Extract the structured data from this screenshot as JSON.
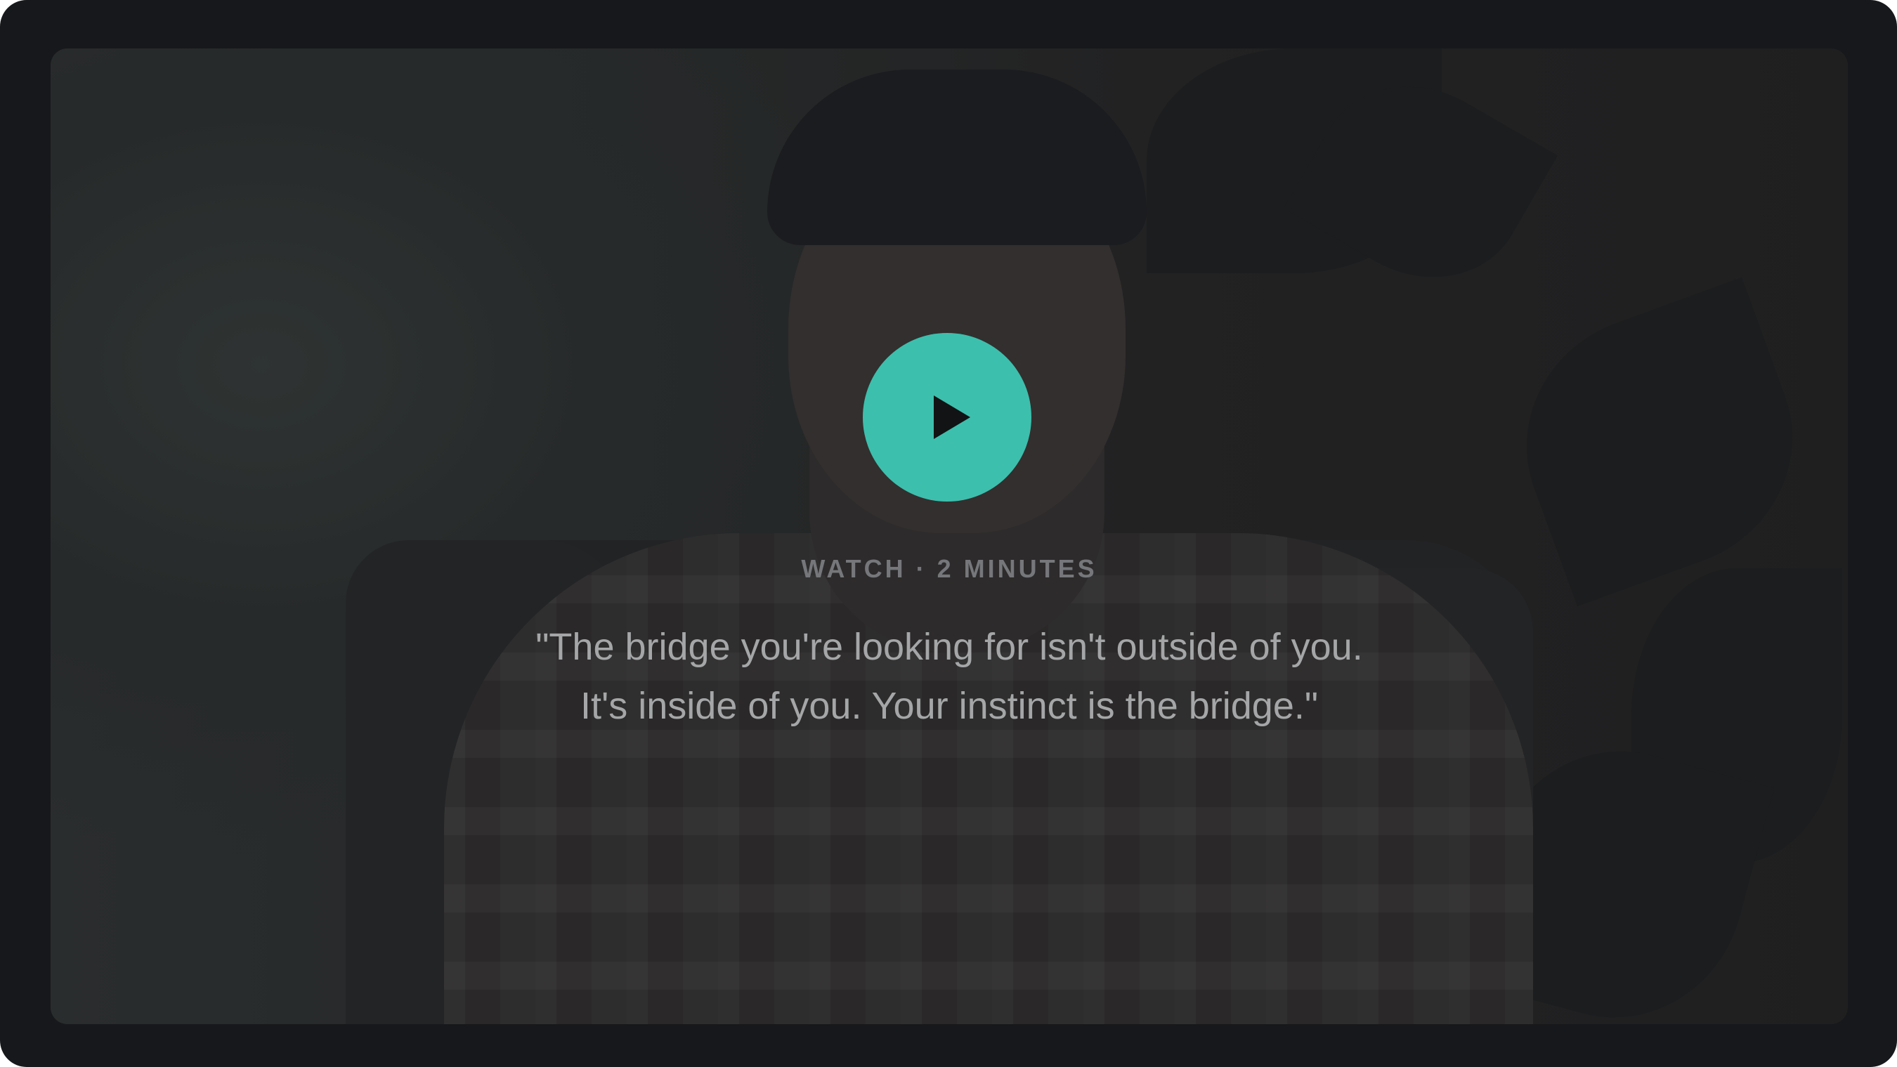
{
  "video": {
    "watch_label": "WATCH · 2 MINUTES",
    "quote_line_1": "\"The bridge you're looking for isn't outside of you.",
    "quote_line_2": "It's inside of you. Your instinct is the bridge.\"",
    "play_icon": "play-icon",
    "accent_color": "#3dbfad"
  }
}
